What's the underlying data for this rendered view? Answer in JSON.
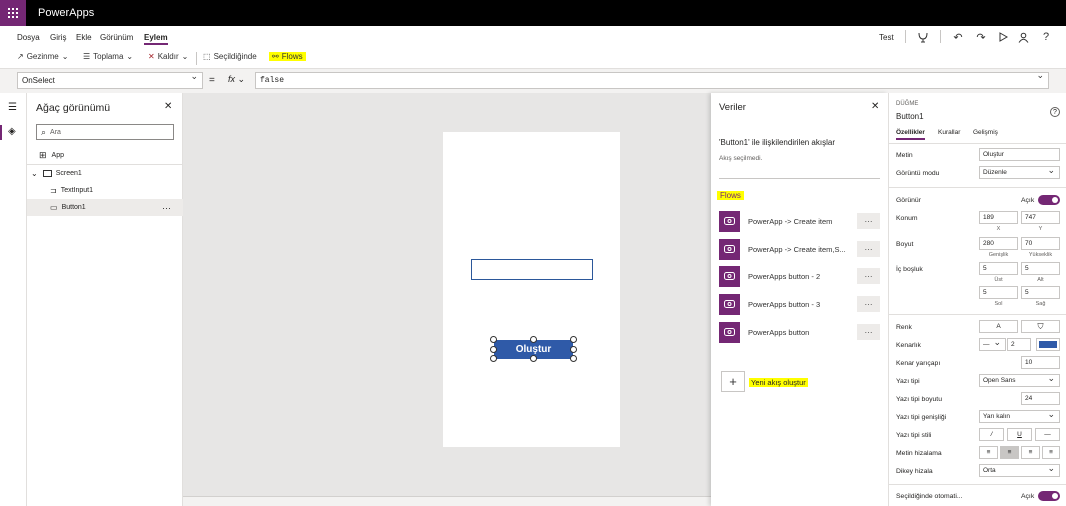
{
  "app": {
    "title": "PowerApps"
  },
  "menu": {
    "items": [
      "Dosya",
      "Giriş",
      "Ekle",
      "Görünüm",
      "Eylem"
    ],
    "active": "Eylem",
    "test_label": "Test"
  },
  "ribbon": {
    "navigate": "Gezinme",
    "collect": "Toplama",
    "remove": "Kaldır",
    "onselect": "Seçildiğinde",
    "flows": "Flows"
  },
  "formula": {
    "property": "OnSelect",
    "fx": "fx",
    "equals": "=",
    "value": "false"
  },
  "tree": {
    "title": "Ağaç görünümü",
    "search_placeholder": "Ara",
    "app": "App",
    "screen": "Screen1",
    "textinput": "TextInput1",
    "button": "Button1",
    "more": "···"
  },
  "canvas": {
    "button_label": "Oluştur"
  },
  "flows": {
    "title": "Veriler",
    "subtitle": "'Button1' ile ilişkilendirilen akışlar",
    "none_selected": "Akış seçilmedi.",
    "section": "Flows",
    "items": [
      "PowerApp -> Create item",
      "PowerApp -> Create item,S...",
      "PowerApps button - 2",
      "PowerApps button - 3",
      "PowerApps button"
    ],
    "more": "···",
    "new_flow": "Yeni akış oluştur"
  },
  "props": {
    "kind": "DÜĞME",
    "name": "Button1",
    "tabs": [
      "Özellikler",
      "Kurallar",
      "Gelişmiş"
    ],
    "text_label": "Metin",
    "text_value": "Oluştur",
    "display_mode_label": "Görüntü modu",
    "display_mode_value": "Düzenle",
    "visible_label": "Görünür",
    "visible_value": "Açık",
    "position_label": "Konum",
    "pos_x": "189",
    "pos_y": "747",
    "x_label": "X",
    "y_label": "Y",
    "size_label": "Boyut",
    "width": "280",
    "height": "70",
    "width_label": "Genişlik",
    "height_label": "Yükseklik",
    "padding_label": "İç boşluk",
    "pad_top": "5",
    "pad_bottom": "5",
    "top_label": "Üst",
    "bottom_label": "Alt",
    "pad_left": "5",
    "pad_right": "5",
    "left_label": "Sol",
    "right_label": "Sağ",
    "color_label": "Renk",
    "color_a": "A",
    "border_label": "Kenarlık",
    "border_width": "2",
    "border_color": "#2f5aa8",
    "radius_label": "Kenar yarıçapı",
    "radius_value": "10",
    "font_label": "Yazı tipi",
    "font_value": "Open Sans",
    "font_size_label": "Yazı tipi boyutu",
    "font_size_value": "24",
    "font_weight_label": "Yazı tipi genişliği",
    "font_weight_value": "Yarı kalın",
    "font_style_label": "Yazı tipi stili",
    "italic": "/",
    "underline": "U",
    "strike": "—",
    "align_label": "Metin hizalama",
    "valign_label": "Dikey hizala",
    "valign_value": "Orta",
    "autodisable_label": "Seçildiğinde otomati...",
    "autodisable_value": "Açık"
  },
  "colors": {
    "brand": "#742774",
    "button": "#2f5aa8",
    "highlight": "#ffff00"
  }
}
